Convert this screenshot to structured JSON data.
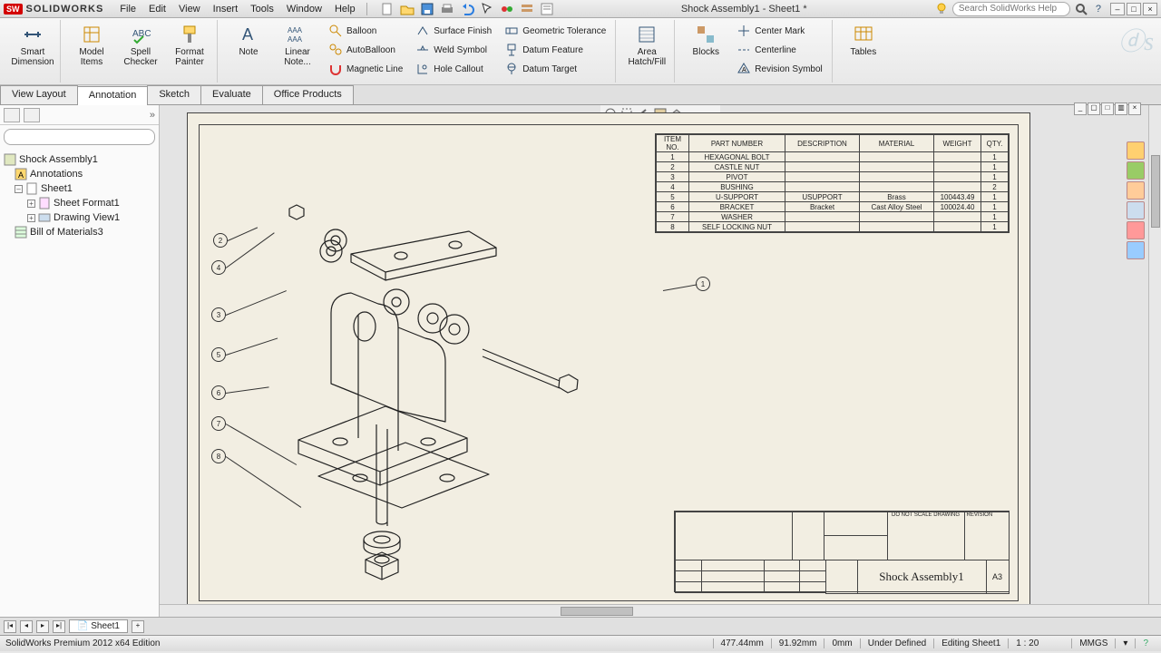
{
  "app": {
    "name": "SOLIDWORKS",
    "doc_title": "Shock Assembly1 - Sheet1 *"
  },
  "search": {
    "placeholder": "Search SolidWorks Help"
  },
  "menus": [
    "File",
    "Edit",
    "View",
    "Insert",
    "Tools",
    "Window",
    "Help"
  ],
  "ribbon": {
    "big": [
      {
        "label": "Smart Dimension"
      },
      {
        "label": "Model Items"
      },
      {
        "label": "Spell Checker"
      },
      {
        "label": "Format Painter"
      },
      {
        "label": "Note"
      },
      {
        "label": "Linear Note..."
      }
    ],
    "col1": [
      "Balloon",
      "AutoBalloon",
      "Magnetic Line"
    ],
    "col2": [
      "Surface Finish",
      "Weld Symbol",
      "Hole Callout"
    ],
    "col3": [
      "Geometric Tolerance",
      "Datum Feature",
      "Datum Target"
    ],
    "mid": [
      {
        "label": "Area Hatch/Fill"
      },
      {
        "label": "Blocks"
      }
    ],
    "col4": [
      "Center Mark",
      "Centerline",
      "Revision Symbol"
    ],
    "right": [
      {
        "label": "Tables"
      }
    ]
  },
  "tabs": [
    "View Layout",
    "Annotation",
    "Sketch",
    "Evaluate",
    "Office Products"
  ],
  "active_tab": "Annotation",
  "tree": {
    "root": "Shock Assembly1",
    "items": [
      {
        "label": "Annotations",
        "level": 1,
        "icon": "A"
      },
      {
        "label": "Sheet1",
        "level": 1,
        "icon": "sheet",
        "exp": "-"
      },
      {
        "label": "Sheet Format1",
        "level": 2,
        "icon": "fmt",
        "exp": "+"
      },
      {
        "label": "Drawing View1",
        "level": 2,
        "icon": "view",
        "exp": "+"
      },
      {
        "label": "Bill of Materials3",
        "level": 1,
        "icon": "bom"
      }
    ]
  },
  "bom": {
    "headers": [
      "ITEM NO.",
      "PART NUMBER",
      "DESCRIPTION",
      "MATERIAL",
      "WEIGHT",
      "QTY."
    ],
    "rows": [
      [
        "1",
        "HEXAGONAL BOLT",
        "",
        "",
        "",
        "1"
      ],
      [
        "2",
        "CASTLE NUT",
        "",
        "",
        "",
        "1"
      ],
      [
        "3",
        "PIVOT",
        "",
        "",
        "",
        "1"
      ],
      [
        "4",
        "BUSHING",
        "",
        "",
        "",
        "2"
      ],
      [
        "5",
        "U-SUPPORT",
        "USUPPORT",
        "Brass",
        "100443.49",
        "1"
      ],
      [
        "6",
        "BRACKET",
        "Bracket",
        "Cast Alloy Steel",
        "100024.40",
        "1"
      ],
      [
        "7",
        "WASHER",
        "",
        "",
        "",
        "1"
      ],
      [
        "8",
        "SELF LOCKING NUT",
        "",
        "",
        "",
        "1"
      ]
    ]
  },
  "balloons": [
    "1",
    "2",
    "3",
    "4",
    "5",
    "6",
    "7",
    "8"
  ],
  "titleblock": {
    "title": "Shock Assembly1",
    "size": "A3",
    "scale_label": "DO NOT SCALE DRAWING",
    "revision": "REVISION"
  },
  "sheet_tab": "Sheet1",
  "status": {
    "edition": "SolidWorks Premium 2012 x64 Edition",
    "x": "477.44mm",
    "y": "91.92mm",
    "z": "0mm",
    "state": "Under Defined",
    "editing": "Editing Sheet1",
    "scale": "1 : 20",
    "units": "MMGS"
  }
}
